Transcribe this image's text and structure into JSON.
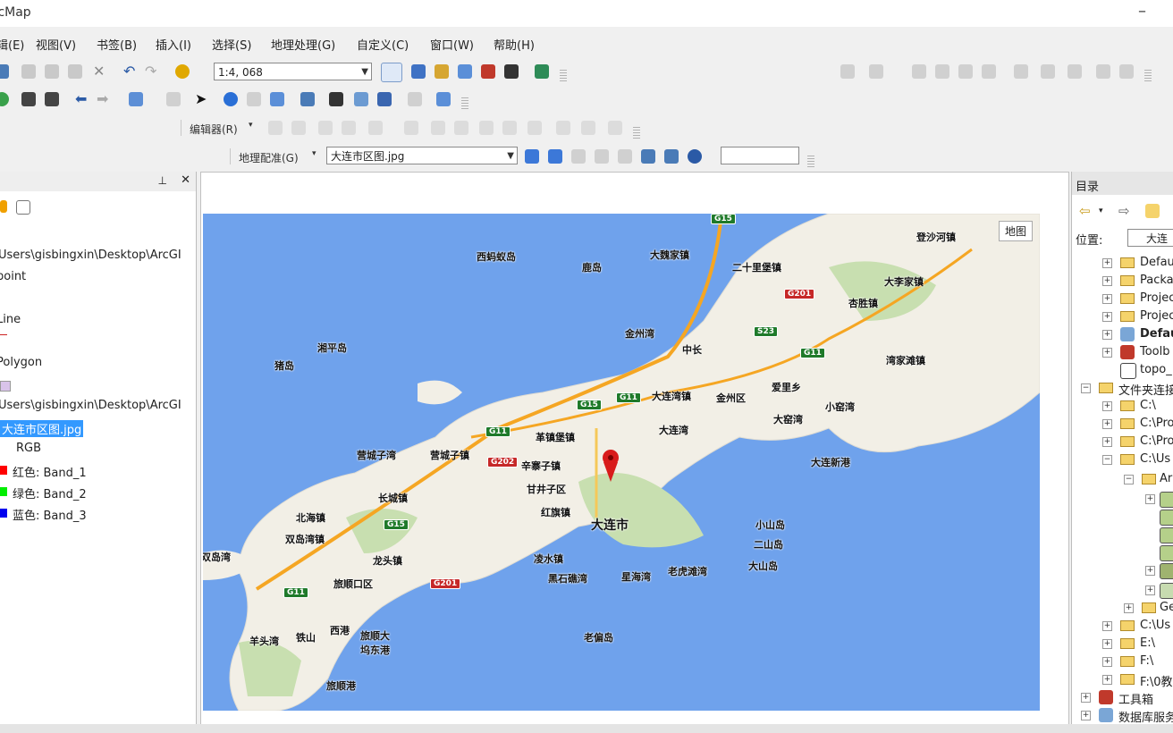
{
  "title": "rcMap",
  "menu": [
    "辑(E)",
    "视图(V)",
    "书签(B)",
    "插入(I)",
    "选择(S)",
    "地理处理(G)",
    "自定义(C)",
    "窗口(W)",
    "帮助(H)"
  ],
  "toolbar": {
    "scale_value": "1:4, 068",
    "editor_label": "编辑器(R)",
    "georef_label": "地理配准(G)",
    "georef_layer": "大连市区图.jpg"
  },
  "toc": {
    "items": [
      "Users\\gisbingxin\\Desktop\\ArcGI",
      "point",
      "Line",
      "Polygon",
      "Users\\gisbingxin\\Desktop\\ArcGI",
      "大连市区图.jpg",
      "RGB",
      "红色:    Band_1",
      "绿色: Band_2",
      "蓝色:    Band_3"
    ],
    "band_colors": [
      "#ff0000",
      "#00ee00",
      "#0000ee"
    ]
  },
  "map": {
    "type_button": "地图",
    "labels": [
      "西蚂蚁岛",
      "鹿岛",
      "大魏家镇",
      "二十里堡镇",
      "登沙河镇",
      "大李家镇",
      "杏胜镇",
      "金州湾",
      "中长",
      "湾家滩镇",
      "湘平岛",
      "猪岛",
      "大连湾镇",
      "金州区",
      "爱里乡",
      "小窑湾",
      "大窑湾",
      "大连湾",
      "大连新港",
      "营城子湾",
      "营城子镇",
      "革镇堡镇",
      "辛寨子镇",
      "甘井子区",
      "长城镇",
      "红旗镇",
      "大连市",
      "北海镇",
      "双岛湾镇",
      "龙头镇",
      "凌水镇",
      "小山岛",
      "二山岛",
      "大山岛",
      "双岛湾",
      "旅顺口区",
      "黑石礁湾",
      "星海湾",
      "老虎滩湾",
      "羊头湾",
      "铁山",
      "西港",
      "旅顺大坞东港",
      "老偏岛",
      "旅顺港"
    ],
    "shields": [
      "G15",
      "G201",
      "S23",
      "G11",
      "G11",
      "G15",
      "G11",
      "G202",
      "G15",
      "G11",
      "G201"
    ]
  },
  "catalog": {
    "title": "目录",
    "location_label": "位置:",
    "location_value": "大连",
    "items": [
      "Defau",
      "Packa",
      "Projec",
      "Projec",
      "Defau",
      "Toolb",
      "topo_",
      "文件夹连接",
      "C:\\",
      "C:\\Pro",
      "C:\\Pro",
      "C:\\Us",
      "Ar",
      "",
      "",
      "",
      "",
      "",
      "Ge",
      "C:\\Us",
      "E:\\",
      "F:\\",
      "F:\\0教",
      "工具箱",
      "数据库服务"
    ]
  }
}
